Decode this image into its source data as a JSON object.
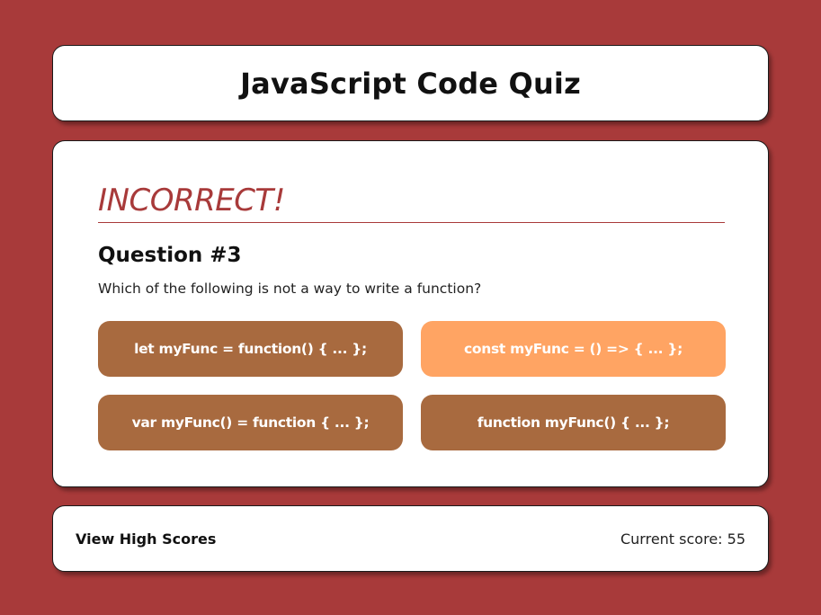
{
  "header": {
    "title": "JavaScript Code Quiz"
  },
  "quiz": {
    "feedback": "INCORRECT!",
    "question_number": "Question #3",
    "question_text": "Which of the following is not a way to write a function?",
    "answers": [
      {
        "label": "let myFunc = function() { ... };",
        "state": "default"
      },
      {
        "label": "const myFunc = () => { ... };",
        "state": "selected"
      },
      {
        "label": "var myFunc() = function { ... };",
        "state": "default"
      },
      {
        "label": "function myFunc() { ... };",
        "state": "default"
      }
    ]
  },
  "footer": {
    "high_scores_label": "View High Scores",
    "score_text": "Current score: 55"
  },
  "colors": {
    "background": "#a83a3a",
    "answer_default": "#a86a3f",
    "answer_selected": "#ffa463",
    "feedback": "#a83a3a"
  }
}
